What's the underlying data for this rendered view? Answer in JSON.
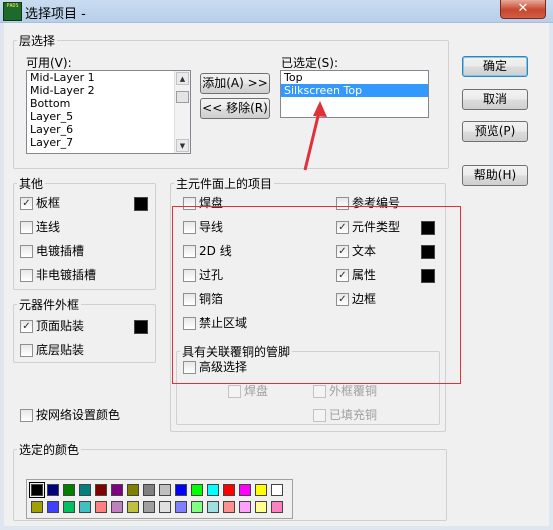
{
  "window": {
    "title": "选择项目 -",
    "icon_text": "PADS",
    "close_glyph": "✕"
  },
  "layers": {
    "group_label": "层选择",
    "available_label": "可用(V):",
    "available_items": [
      "Mid-Layer 1",
      "Mid-Layer 2",
      "Bottom",
      "Layer_5",
      "Layer_6",
      "Layer_7"
    ],
    "add_button": "添加(A) >>",
    "remove_button": "<< 移除(R)",
    "selected_label": "已选定(S):",
    "selected_items": [
      "Top",
      "Silkscreen Top"
    ],
    "selected_highlight_index": 1
  },
  "buttons": {
    "ok": "确定",
    "cancel": "取消",
    "preview": "预览(P)",
    "help": "帮助(H)"
  },
  "other": {
    "group_label": "其他",
    "items": [
      {
        "label": "板框",
        "checked": true,
        "color": "#000000"
      },
      {
        "label": "连线",
        "checked": false
      },
      {
        "label": "电镀插槽",
        "checked": false
      },
      {
        "label": "非电镀插槽",
        "checked": false
      }
    ]
  },
  "outline": {
    "group_label": "元器件外框",
    "items": [
      {
        "label": "顶面贴装",
        "checked": true,
        "color": "#000000"
      },
      {
        "label": "底层贴装",
        "checked": false
      }
    ]
  },
  "component_items": {
    "group_label": "主元件面上的项目",
    "left": [
      {
        "label": "焊盘",
        "checked": false
      },
      {
        "label": "导线",
        "checked": false
      },
      {
        "label": "2D 线",
        "checked": false
      },
      {
        "label": "过孔",
        "checked": false
      },
      {
        "label": "铜箔",
        "checked": false
      },
      {
        "label": "禁止区域",
        "checked": false
      }
    ],
    "right": [
      {
        "label": "参考编号",
        "checked": false
      },
      {
        "label": "元件类型",
        "checked": true,
        "color": "#000000"
      },
      {
        "label": "文本",
        "checked": true,
        "color": "#000000"
      },
      {
        "label": "属性",
        "checked": true,
        "color": "#000000"
      },
      {
        "label": "边框",
        "checked": true
      }
    ]
  },
  "pins": {
    "group_label": "具有关联覆铜的管脚",
    "advanced": {
      "label": "高级选择",
      "checked": false
    },
    "pad": {
      "label": "焊盘",
      "checked": false,
      "disabled": true
    },
    "outline_copper": {
      "label": "外框覆铜",
      "checked": false,
      "disabled": true
    },
    "filled_copper": {
      "label": "已填充铜",
      "checked": false,
      "disabled": true
    }
  },
  "net_color": {
    "label": "按网络设置颜色",
    "checked": false
  },
  "colors": {
    "group_label": "选定的颜色",
    "row1": [
      "#000000",
      "#000080",
      "#008000",
      "#008080",
      "#800000",
      "#800080",
      "#808000",
      "#808080",
      "#c0c0c0",
      "#0000ff",
      "#00ff00",
      "#00ffff",
      "#ff0000",
      "#ff00ff",
      "#ffff00",
      "#ffffff"
    ],
    "row2": [
      "#a0a000",
      "#4040ff",
      "#00c060",
      "#40c0c0",
      "#ff8080",
      "#c080c0",
      "#c0c040",
      "#a0a0a0",
      "#e0e0e0",
      "#8080ff",
      "#80ff80",
      "#a0e0e0",
      "#ff9090",
      "#ffa0ff",
      "#ffff90",
      "#ff80c0"
    ],
    "selected_index": 0
  },
  "annotation": {
    "color": "#e0303a"
  }
}
